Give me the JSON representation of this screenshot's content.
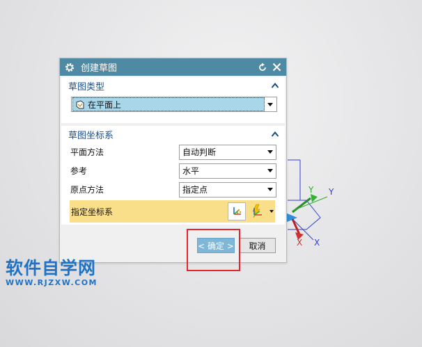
{
  "dialog": {
    "title": "创建草图",
    "icons": {
      "settings": "gear-icon",
      "reset": "reset-icon",
      "close": "close-icon"
    }
  },
  "sketch_type": {
    "header": "草图类型",
    "selected": "在平面上"
  },
  "sketch_csys": {
    "header": "草图坐标系",
    "plane_method": {
      "label": "平面方法",
      "value": "自动判断"
    },
    "reference": {
      "label": "参考",
      "value": "水平"
    },
    "origin_method": {
      "label": "原点方法",
      "value": "指定点"
    },
    "specify_csys": {
      "label": "指定坐标系"
    }
  },
  "buttons": {
    "ok": "< 确定 >",
    "cancel": "取消"
  },
  "triad": {
    "y1": "Y",
    "y2": "Y",
    "x1": "X",
    "x2": "X"
  },
  "watermark": {
    "main": "软件自学网",
    "sub": "WWW.RJZXW.COM"
  },
  "colors": {
    "titlebar": "#4f8aa4",
    "section_header": "#1b4f8a",
    "highlight_row": "#fadf8a",
    "ok_button": "#7fb7d8",
    "annotation_box": "#e0262e",
    "watermark": "#1f72c4"
  }
}
